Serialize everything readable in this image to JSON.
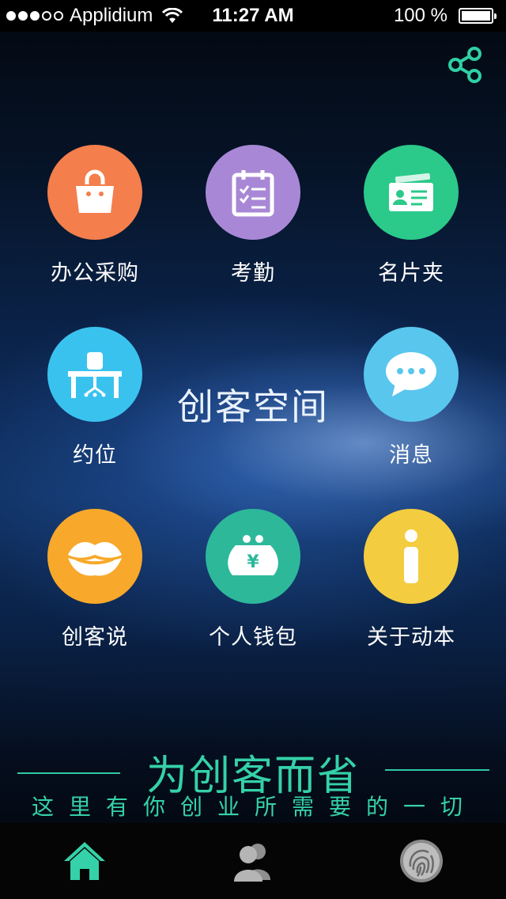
{
  "status_bar": {
    "carrier": "Applidium",
    "time": "11:27 AM",
    "battery": "100 %"
  },
  "header": {
    "share_icon": "share-icon"
  },
  "center_title": "创客空间",
  "tiles": [
    {
      "label": "办公采购",
      "icon": "shopping-bag-icon",
      "color": "#f47e4c"
    },
    {
      "label": "考勤",
      "icon": "calendar-checklist-icon",
      "color": "#a888d6"
    },
    {
      "label": "名片夹",
      "icon": "business-card-icon",
      "color": "#2bc98a"
    },
    {
      "label": "约位",
      "icon": "desk-chair-icon",
      "color": "#3ac2ef"
    },
    {
      "label": "消息",
      "icon": "chat-bubble-icon",
      "color": "#59c6ee"
    },
    {
      "label": "创客说",
      "icon": "lips-icon",
      "color": "#f8a82a"
    },
    {
      "label": "个人钱包",
      "icon": "wallet-purse-icon",
      "color": "#2db89a"
    },
    {
      "label": "关于动本",
      "icon": "info-icon",
      "color": "#f3cc3f"
    }
  ],
  "slogan": {
    "main": "为创客而省",
    "sub": "这里有你创业所需要的一切"
  },
  "tabbar": {
    "items": [
      {
        "icon": "home-icon",
        "active": true,
        "color": "#35d1a8"
      },
      {
        "icon": "users-icon",
        "active": false
      },
      {
        "icon": "fingerprint-icon",
        "active": false
      }
    ]
  }
}
